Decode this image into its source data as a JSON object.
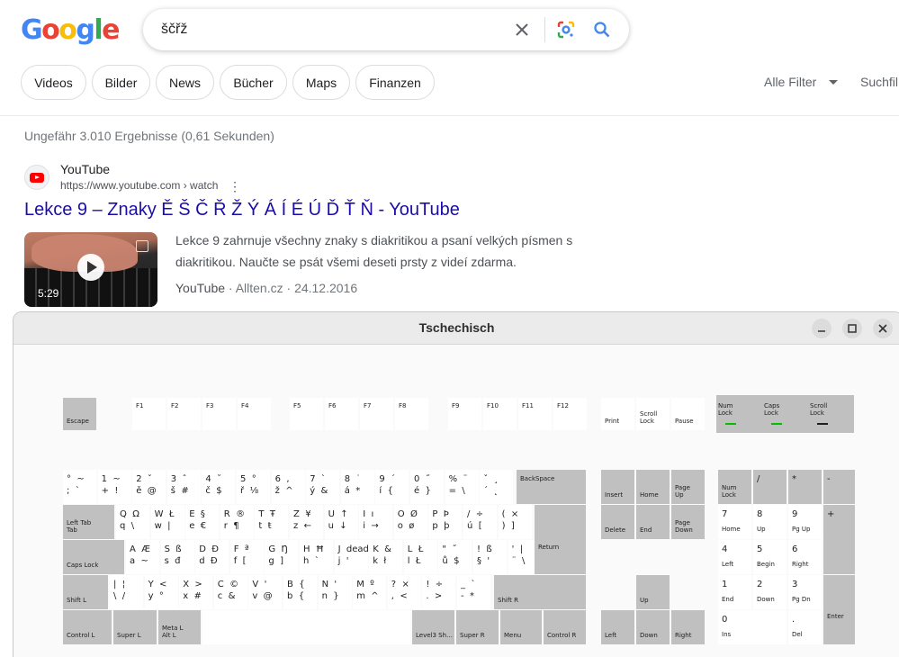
{
  "colors": {
    "g_blue": "#4285f4",
    "g_red": "#ea4335",
    "g_yellow": "#fbbc05",
    "g_green": "#34a853",
    "link": "#1a0dab",
    "key_gray": "#c0c0c0",
    "led_on": "#00c000",
    "led_off": "#202020"
  },
  "logo": "Google",
  "search": {
    "query": "ščřž",
    "clear_icon": "close-icon",
    "lens_icon": "google-lens-icon",
    "search_icon": "search-icon"
  },
  "chips": [
    "Videos",
    "Bilder",
    "News",
    "Bücher",
    "Maps",
    "Finanzen"
  ],
  "tools": {
    "all_filters": "Alle Filter",
    "safesearch": "Suchfil"
  },
  "stats": "Ungefähr 3.010 Ergebnisse (0,61 Sekunden)",
  "result": {
    "site": "YouTube",
    "url": "https://www.youtube.com › watch",
    "title": "Lekce 9 – Znaky Ě Š Č Ř Ž Ý Á Í É Ú Ď Ť Ň - YouTube",
    "duration": "5:29",
    "snippet": "Lekce 9 zahrnuje všechny znaky s diakritikou a psaní velkých písmen s diakritikou. Naučte se psát všemi deseti prsty z videí zdarma.",
    "source": "YouTube",
    "publisher": "Allten.cz",
    "date": "24.12.2016"
  },
  "window": {
    "title": "Tschechisch",
    "buttons": [
      "minimize-icon",
      "maximize-icon",
      "close-icon"
    ]
  },
  "keyboard": {
    "fn": [
      "Escape",
      "F1",
      "F2",
      "F3",
      "F4",
      "F5",
      "F6",
      "F7",
      "F8",
      "F9",
      "F10",
      "F11",
      "F12",
      "Print",
      "Scroll\nLock",
      "Pause",
      "Num\nLock",
      "Caps\nLock",
      "Scroll\nLock"
    ],
    "row1": [
      "°  ~\n;  `",
      "1  ~\n+  !",
      "2  ˇ\ně  @",
      "3  ˆ\nš  #",
      "4  ˘\nč  $",
      "5  °\nř  ⅛",
      "6  ,\nž  ^",
      "7  `\ný  &",
      "8  ˙\ná  *",
      "9  ´\ní  {",
      "0  ˝\né  }",
      "%  ¨\n=  \\",
      "ˇ  ¸\n´  ˛",
      "BackSpace"
    ],
    "row2": [
      "Left Tab\nTab",
      "Q  Ω\nq  \\",
      "W  Ł\nw  |",
      "E  §\ne  €",
      "R  ®\nr  ¶",
      "T  Ŧ\nt  ŧ",
      "Z  ¥\nz  ←",
      "U  ↑\nu  ↓",
      "I  ı\ni  →",
      "O  Ø\no  ø",
      "P  Þ\np  þ",
      "/  ÷\nú  [",
      "(  ×\n)  ]"
    ],
    "row3": [
      "Caps Lock",
      "A  Æ\na  ~",
      "S  ß\ns  đ",
      "D  Đ\nd  Đ",
      "F  ª\nf  [",
      "G  Ŋ\ng  ]",
      "H  Ħ\nh  `",
      "J  dead…\nj  '",
      "K  &\nk  ł",
      "L  Ł\nl  Ł",
      "\"  ˝\nů  $",
      "!  ß\n§  '",
      "'  |\n¨  \\",
      "Return"
    ],
    "row4": [
      "Shift L",
      "|  ¦\n\\  /",
      "Y  <\ny  °",
      "X  >\nx  #",
      "C  ©\nc  &",
      "V  '\nv  @",
      "B  {\nb  {",
      "N  '\nn  }",
      "M  º\nm  ^",
      "?  ×\n,  <",
      "!  ÷\n.  >",
      "_  `\n-  *",
      "Shift R"
    ],
    "row5": [
      "Control L",
      "Super L",
      "Meta L\nAlt L",
      "",
      "Level3 Sh…",
      "Super R",
      "Menu",
      "Control R"
    ],
    "nav": [
      "Insert",
      "Home",
      "Page\nUp",
      "Delete",
      "End",
      "Page\nDown",
      "Up",
      "Left",
      "Down",
      "Right"
    ],
    "numpad": [
      "Num\nLock",
      "/",
      "*",
      "-",
      "7\nHome",
      "8\nUp",
      "9\nPg Up",
      "+",
      "4\nLeft",
      "5\nBegin",
      "6\nRight",
      "1\nEnd",
      "2\nDown",
      "3\nPg Dn",
      "Enter",
      "0\nIns",
      ".\nDel"
    ]
  }
}
